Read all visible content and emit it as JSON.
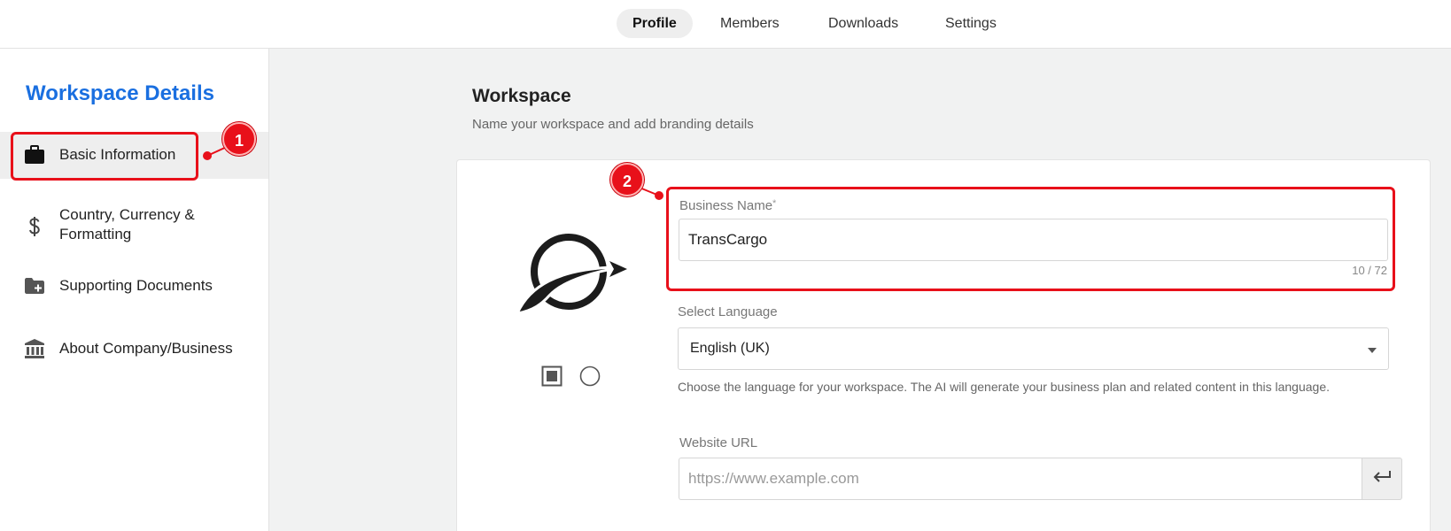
{
  "nav": {
    "tabs": [
      {
        "label": "Profile",
        "active": true
      },
      {
        "label": "Members",
        "active": false
      },
      {
        "label": "Downloads",
        "active": false
      },
      {
        "label": "Settings",
        "active": false
      }
    ]
  },
  "sidebar": {
    "title": "Workspace Details",
    "items": [
      {
        "label": "Basic Information",
        "icon": "briefcase-icon",
        "active": true
      },
      {
        "label": "Country, Currency & Formatting",
        "icon": "dollar-icon",
        "active": false
      },
      {
        "label": "Supporting Documents",
        "icon": "folder-add-icon",
        "active": false
      },
      {
        "label": "About Company/Business",
        "icon": "bank-icon",
        "active": false
      }
    ]
  },
  "main": {
    "title": "Workspace",
    "subtitle": "Name your workspace and add branding details",
    "business_name": {
      "label": "Business Name",
      "required_mark": "*",
      "value": "TransCargo",
      "counter": "10 / 72"
    },
    "language": {
      "label": "Select Language",
      "value": "English (UK)",
      "help": "Choose the language for your workspace. The AI will generate your business plan and related content in this language."
    },
    "website": {
      "label": "Website URL",
      "placeholder": "https://www.example.com",
      "value": ""
    },
    "logo_shape_options": [
      "square",
      "circle"
    ]
  },
  "annotations": [
    {
      "number": "1",
      "target": "Basic Information"
    },
    {
      "number": "2",
      "target": "Business Name"
    }
  ],
  "colors": {
    "accent": "#1a6fe0",
    "annotation": "#e8101a"
  }
}
